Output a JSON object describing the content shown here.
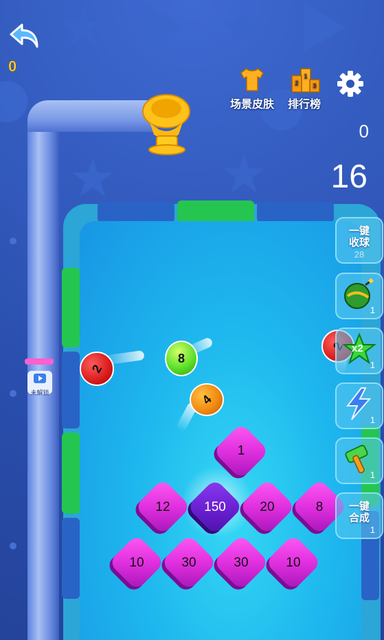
{
  "hud": {
    "score_left": "0",
    "score_right": "0",
    "ball_count": "16"
  },
  "top_buttons": {
    "scene_skin": "场景皮肤",
    "leaderboard": "排行榜"
  },
  "unlock_label": "未解锁",
  "side_buttons": {
    "collect": {
      "label": "一键收球",
      "count": "28"
    },
    "bomb": {
      "count": "1"
    },
    "star_x2": {
      "badge": "x2",
      "count": "1"
    },
    "lightning": {
      "count": "1"
    },
    "hammer": {
      "count": "1"
    },
    "merge": {
      "label": "一键合成",
      "count": "1"
    }
  },
  "balls": [
    {
      "value": "2",
      "color": "#d81b1b"
    },
    {
      "value": "8",
      "color": "#5de02a"
    },
    {
      "value": "4",
      "color": "#f28a12"
    },
    {
      "value": "2",
      "color": "#d81b1b"
    }
  ],
  "tiles": {
    "row1": [
      "1"
    ],
    "row2": [
      "12",
      "150",
      "20",
      "8"
    ],
    "row3": [
      "10",
      "30",
      "30",
      "10"
    ]
  },
  "colors": {
    "background": "#2f56b8",
    "board": "#1eb7ee",
    "tile": "#e130df",
    "tile_highlight": "#6a1fd2",
    "score": "#ffd23a"
  },
  "icons": [
    "back-arrow-icon",
    "tshirt-icon",
    "podium-icon",
    "gear-icon",
    "video-icon",
    "bomb-icon",
    "star-icon",
    "lightning-icon",
    "hammer-icon"
  ]
}
